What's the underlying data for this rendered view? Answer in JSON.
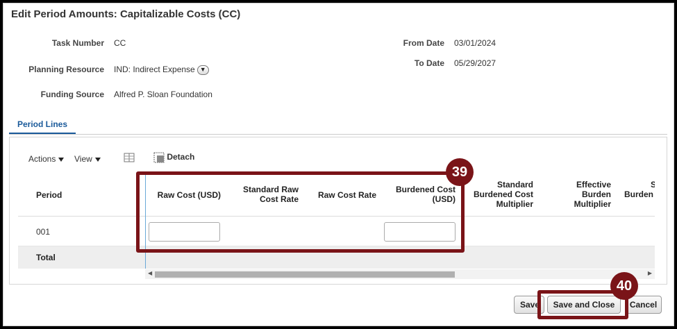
{
  "page": {
    "title": "Edit Period Amounts: Capitalizable Costs (CC)"
  },
  "details": {
    "task_number_label": "Task Number",
    "task_number_value": "CC",
    "planning_resource_label": "Planning Resource",
    "planning_resource_value": "IND: Indirect Expense",
    "funding_source_label": "Funding Source",
    "funding_source_value": "Alfred P. Sloan Foundation",
    "from_date_label": "From Date",
    "from_date_value": "03/01/2024",
    "to_date_label": "To Date",
    "to_date_value": "05/29/2027"
  },
  "tabs": [
    {
      "label": "Period Lines"
    }
  ],
  "toolbar": {
    "actions_label": "Actions",
    "view_label": "View",
    "detach_label": "Detach"
  },
  "table": {
    "columns": [
      "Period",
      "Raw Cost (USD)",
      "Standard Raw Cost Rate",
      "Raw Cost Rate",
      "Burdened Cost (USD)",
      "Standard Burdened Cost Multiplier",
      "Effective Burden Multiplier",
      "S Burden"
    ],
    "column_lines": {
      "std_raw_1": "Standard Raw",
      "std_raw_2": "Cost Rate",
      "burdened_1": "Burdened Cost",
      "burdened_2": "(USD)",
      "std_burd_1": "Standard",
      "std_burd_2": "Burdened Cost",
      "std_burd_3": "Multiplier",
      "eff_1": "Effective",
      "eff_2": "Burden",
      "eff_3": "Multiplier",
      "cut_1": "S",
      "cut_2": "Burden"
    },
    "rows": [
      {
        "period": "001",
        "raw_cost": "",
        "burdened_cost": ""
      }
    ],
    "total_label": "Total"
  },
  "buttons": {
    "save": "Save",
    "save_and_close": "Save and Close",
    "cancel": "Cancel"
  },
  "callouts": {
    "step_39": "39",
    "step_40": "40"
  },
  "colors": {
    "callout": "#7a1418",
    "tab_accent": "#1a5a9a"
  }
}
